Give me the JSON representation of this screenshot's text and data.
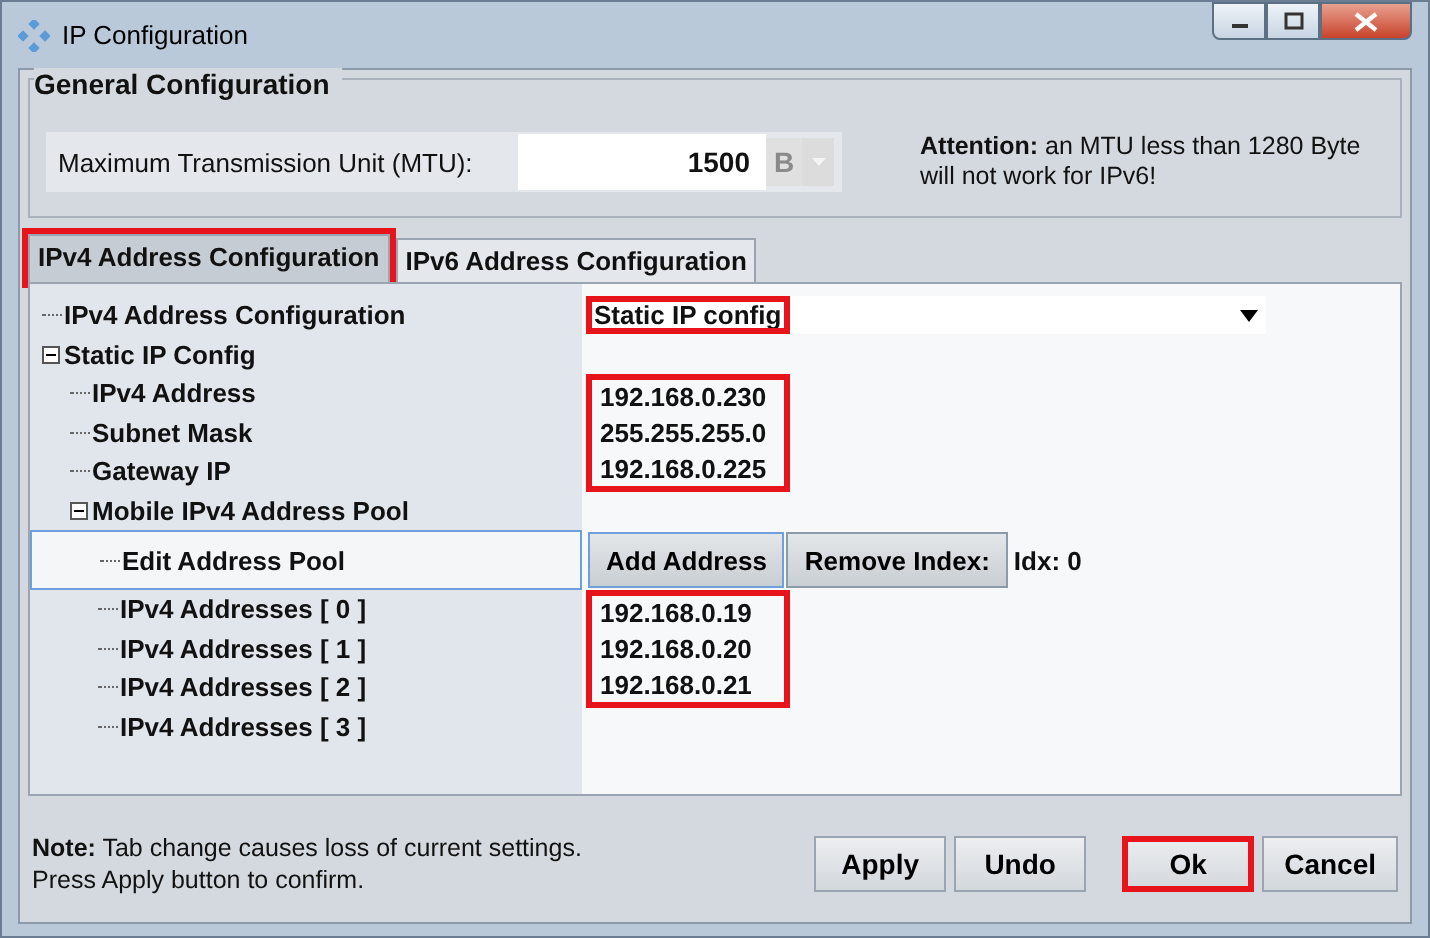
{
  "window": {
    "title": "IP Configuration"
  },
  "general": {
    "title": "General Configuration",
    "mtu_label": "Maximum Transmission Unit (MTU):",
    "mtu_value": "1500",
    "unit": "B",
    "attention": "**Attention:** an MTU less than 1280 Byte\nwill not work for IPv6!"
  },
  "tabs": [
    {
      "label": "IPv4 Address Configuration",
      "selected": true,
      "highlighted": true
    },
    {
      "label": "IPv6 Address Configuration",
      "selected": false,
      "highlighted": false
    }
  ],
  "tree": [
    {
      "label": "IPv4 Address Configuration",
      "kind": "combo",
      "value": "Static IP config",
      "highlighted": true
    },
    {
      "label": "Static IP Config",
      "kind": "group",
      "expanded": true,
      "children": [
        {
          "label": "IPv4 Address",
          "kind": "text",
          "value": "192.168.0.230",
          "highlighted": true
        },
        {
          "label": "Subnet Mask",
          "kind": "text",
          "value": "255.255.255.0",
          "highlighted": true
        },
        {
          "label": "Gateway IP",
          "kind": "text",
          "value": "192.168.0.225",
          "highlighted": true
        },
        {
          "label": "Mobile IPv4 Address Pool",
          "kind": "group",
          "expanded": true,
          "children": [
            {
              "label": "Edit Address Pool",
              "kind": "actions",
              "buttons": [
                "Add Address",
                "Remove Index:"
              ],
              "index": "Idx: 0"
            },
            {
              "label": "IPv4 Addresses [ 0 ]",
              "kind": "text",
              "value": "192.168.0.19",
              "highlighted": true
            },
            {
              "label": "IPv4 Addresses [ 1 ]",
              "kind": "text",
              "value": "192.168.0.20",
              "highlighted": true
            },
            {
              "label": "IPv4 Addresses [ 2 ]",
              "kind": "text",
              "value": "192.168.0.21",
              "highlighted": true
            },
            {
              "label": "IPv4 Addresses [ 3 ]",
              "kind": "text",
              "highlighted": false
            }
          ]
        }
      ]
    }
  ],
  "footer": {
    "note": "**Note:** Tab change causes loss of current settings.\nPress Apply button to confirm.",
    "buttons": [
      {
        "label": "Apply",
        "highlighted": false
      },
      {
        "label": "Undo",
        "highlighted": false
      },
      {
        "label": "Ok",
        "highlighted": true
      },
      {
        "label": "Cancel",
        "highlighted": false
      }
    ]
  }
}
